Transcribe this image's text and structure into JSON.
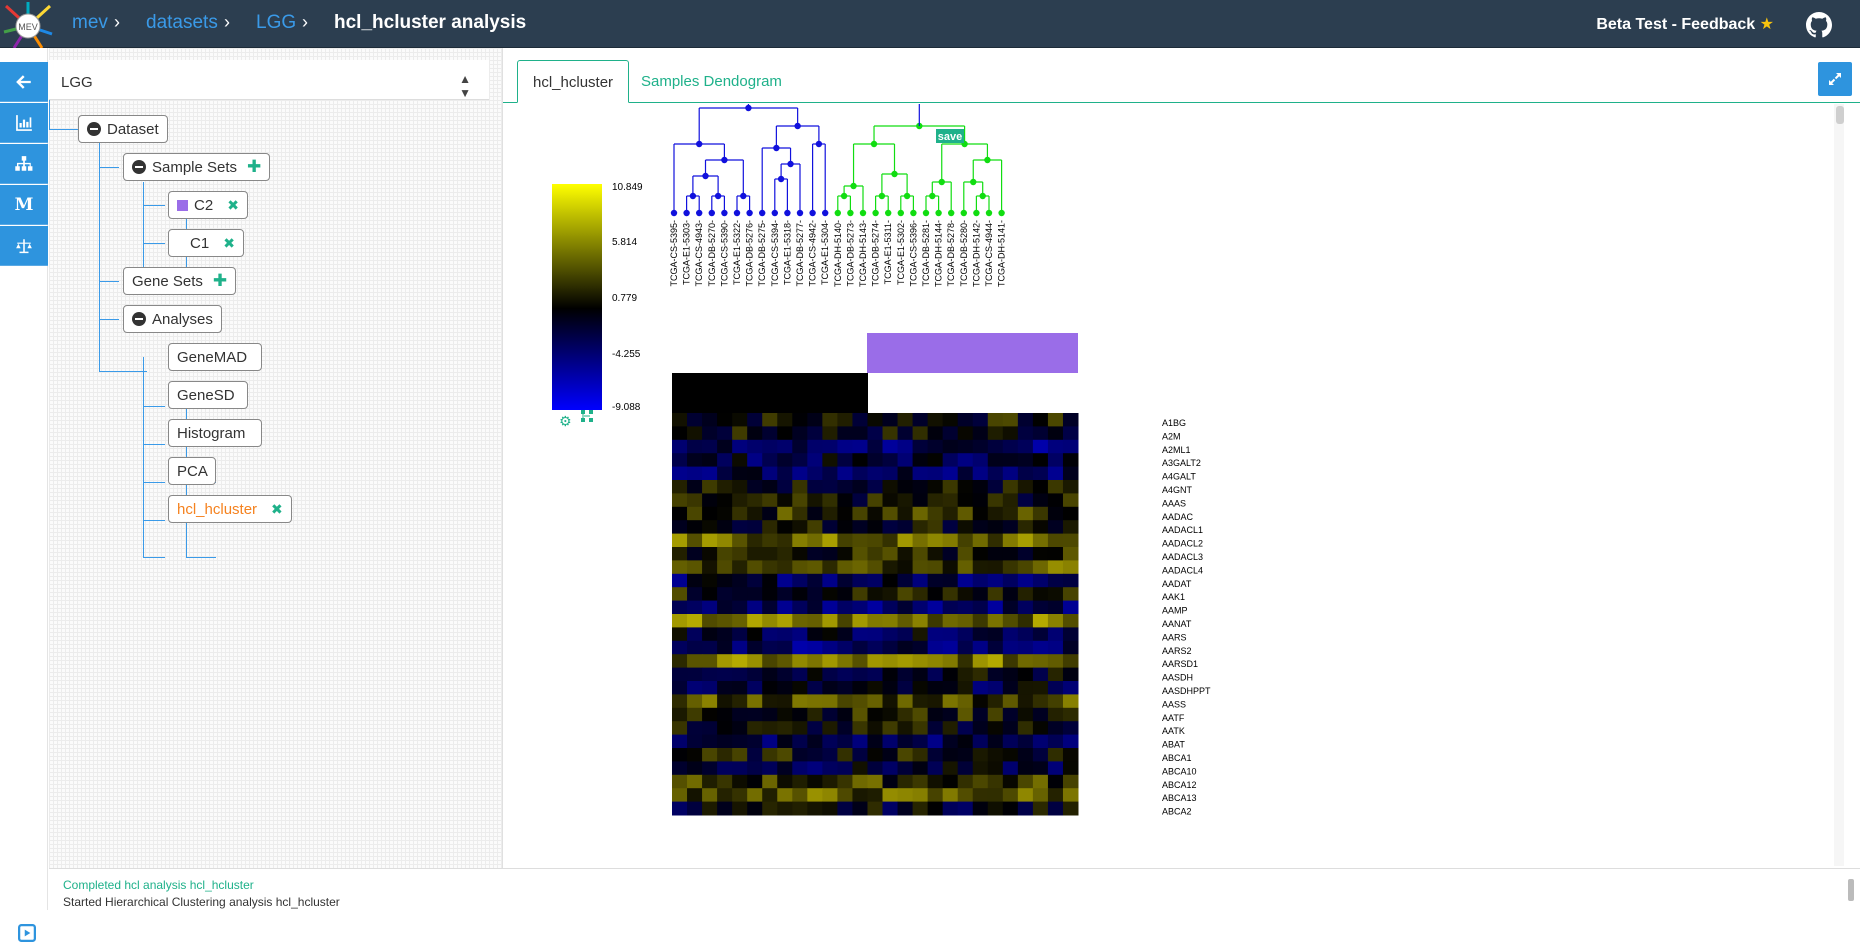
{
  "header": {
    "breadcrumbs": [
      "mev",
      "datasets",
      "LGG"
    ],
    "current": "hcl_hcluster analysis",
    "feedback": "Beta Test - Feedback",
    "logo_text": "MEV"
  },
  "colors": {
    "accent": "#1fb18a",
    "link": "#3a9ae8",
    "header_bg": "#2c3e50",
    "group": "#9a6de8",
    "cluster_a": "#1111dd",
    "cluster_b": "#11dd11"
  },
  "rail": {
    "icons": [
      "back-arrow-icon",
      "bar-chart-icon",
      "sitemap-icon",
      "m-icon",
      "balance-scale-icon"
    ]
  },
  "tree": {
    "dataset_select": "LGG",
    "root": "Dataset",
    "sample_sets_label": "Sample Sets",
    "sample_sets": [
      "C2",
      "C1"
    ],
    "gene_sets_label": "Gene Sets",
    "analyses_label": "Analyses",
    "analyses": [
      "GeneMAD",
      "GeneSD",
      "Histogram",
      "PCA",
      "hcl_hcluster"
    ]
  },
  "tabs": [
    "hcl_hcluster",
    "Samples Dendogram"
  ],
  "viz": {
    "save_label": "save",
    "legend_values": [
      "10.849",
      "5.814",
      "0.779",
      "-4.255",
      "-9.088"
    ],
    "samples_blue": [
      "TCGA-CS-5395-",
      "TCGA-E1-5303-",
      "TCGA-CS-4943-",
      "TCGA-DB-5270-",
      "TCGA-CS-5390-",
      "TCGA-E1-5322-",
      "TCGA-DB-5276-",
      "TCGA-DB-5275-",
      "TCGA-CS-5394-",
      "TCGA-E1-5318-",
      "TCGA-DB-5277-",
      "TCGA-CS-4942-",
      "TCGA-E1-5304-"
    ],
    "samples_green": [
      "TCGA-DH-5140-",
      "TCGA-DB-5273-",
      "TCGA-DH-5143-",
      "TCGA-DB-5274-",
      "TCGA-E1-5311-",
      "TCGA-E1-5302-",
      "TCGA-CS-5396-",
      "TCGA-DB-5281-",
      "TCGA-DH-5144-",
      "TCGA-DB-5278-",
      "TCGA-DB-5280-",
      "TCGA-DH-5142-",
      "TCGA-CS-4944-",
      "TCGA-DH-5141-"
    ],
    "genes": [
      "A1BG",
      "A2M",
      "A2ML1",
      "A3GALT2",
      "A4GALT",
      "A4GNT",
      "AAAS",
      "AADAC",
      "AADACL1",
      "AADACL2",
      "AADACL3",
      "AADACL4",
      "AADAT",
      "AAK1",
      "AAMP",
      "AANAT",
      "AARS",
      "AARS2",
      "AARSD1",
      "AASDH",
      "AASDHPPT",
      "AASS",
      "AATF",
      "AATK",
      "ABAT",
      "ABCA1",
      "ABCA10",
      "ABCA12",
      "ABCA13",
      "ABCA2"
    ]
  },
  "status": {
    "completed": "Completed hcl analysis hcl_hcluster",
    "started": "Started Hierarchical Clustering analysis hcl_hcluster"
  }
}
